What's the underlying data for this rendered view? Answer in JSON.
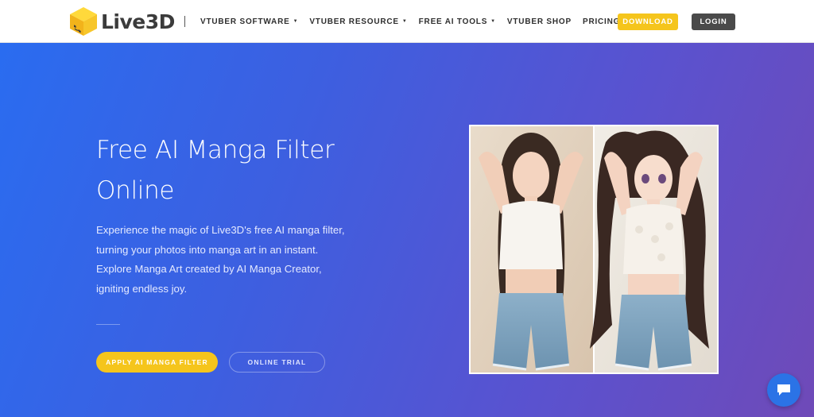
{
  "header": {
    "logo_text": "Live3D",
    "nav": [
      {
        "label": "VTUBER SOFTWARE",
        "has_dropdown": true
      },
      {
        "label": "VTUBER RESOURCE",
        "has_dropdown": true
      },
      {
        "label": "FREE AI TOOLS",
        "has_dropdown": true
      },
      {
        "label": "VTUBER SHOP",
        "has_dropdown": false
      },
      {
        "label": "PRICING",
        "has_dropdown": false
      }
    ],
    "download_label": "DOWNLOAD",
    "login_label": "LOGIN"
  },
  "hero": {
    "title_line1": "Free AI Manga Filter",
    "title_line2": "Online",
    "description": "Experience the magic of Live3D's free AI manga filter, turning your photos into manga art in an instant. Explore Manga Art created by AI Manga Creator, igniting endless joy.",
    "primary_button": "APPLY AI MANGA FILTER",
    "secondary_button": "ONLINE TRIAL"
  },
  "colors": {
    "accent_yellow": "#f5c51c",
    "login_bg": "#4a4a4a",
    "gradient_start": "#2a6cf0",
    "gradient_end": "#6f4ab8",
    "chat_blue": "#2b73e6"
  },
  "icons": {
    "logo": "yellow-cube-face-icon",
    "dropdown": "caret-down-icon",
    "chat": "chat-bubble-icon"
  }
}
